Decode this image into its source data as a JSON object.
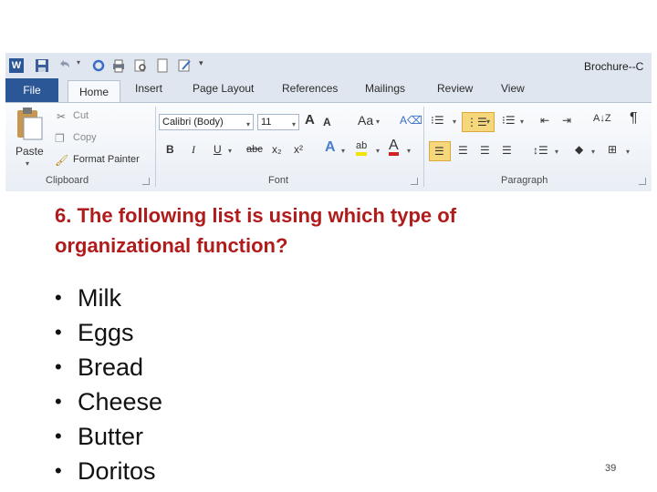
{
  "window": {
    "doc_title": "Brochure--C"
  },
  "ribbon": {
    "tabs": [
      "File",
      "Home",
      "Insert",
      "Page Layout",
      "References",
      "Mailings",
      "Review",
      "View"
    ],
    "clipboard": {
      "paste": "Paste",
      "cut": "Cut",
      "copy": "Copy",
      "format_painter": "Format Painter",
      "group": "Clipboard"
    },
    "font": {
      "name": "Calibri (Body)",
      "size": "11",
      "bold": "B",
      "italic": "I",
      "underline": "U",
      "strike": "abc",
      "subscript": "x₂",
      "superscript": "x²",
      "change_case": "Aa",
      "grow": "A",
      "shrink": "A",
      "group": "Font"
    },
    "paragraph": {
      "group": "Paragraph",
      "pilcrow": "¶"
    }
  },
  "slide": {
    "question": "6. The following list is using which type of organizational function?",
    "items": [
      "Milk",
      "Eggs",
      "Bread",
      "Cheese",
      "Butter",
      "Doritos"
    ],
    "page_number": "39"
  },
  "colors": {
    "question": "#b01b1b",
    "file_tab": "#2b5797",
    "highlight": "#f6d77b"
  }
}
